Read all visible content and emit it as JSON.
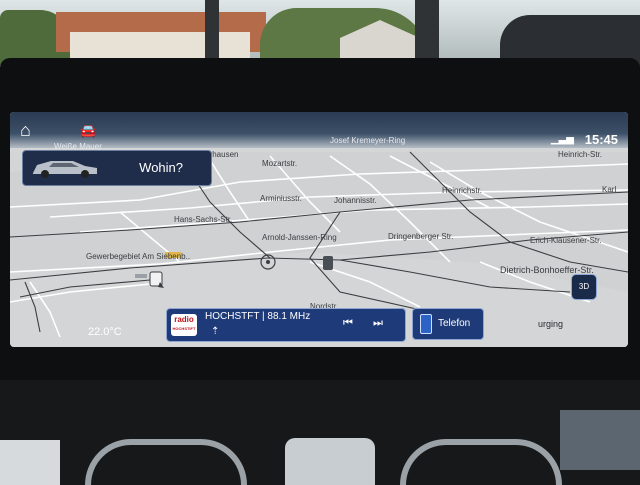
{
  "topbar": {
    "home_icon": "home-icon",
    "car_icon": "car-icon",
    "signal_icon": "signal-icon",
    "time": "15:45"
  },
  "destination_button": {
    "label": "Wohin?"
  },
  "map": {
    "street_labels": {
      "weisse_mauer": "Weiße Mauer",
      "jose_kremeyer": "Josef Kremeyer-Ring",
      "heinrich_str_top": "Heinrich-Str.",
      "thausen": "thausen",
      "mozartstr": "Mozartstr.",
      "heinrichstr": "Heinrichstr.",
      "karl": "Karl",
      "arminiusstr": "Arminiusstr.",
      "johannisstr": "Johannisstr.",
      "hans_sachs": "Hans-Sachs-Str.",
      "arnold_janssen": "Arnold-Janssen-Ring",
      "dringenberger": "Dringenberger Str.",
      "erich_klausener": "Erich-Klausener-Str.",
      "gewerbegebiet": "Gewerbegebiet Am Siebenb..",
      "dietrich": "Dietrich-Bonhoeffer-Str.",
      "nordstr": "Nordstr."
    }
  },
  "bottombar": {
    "temperature": "22.0°C",
    "radio": {
      "logo_text": "radio",
      "logo_subtext": "HOCHSTIFT",
      "station": "HOCHSTFT | 88.1 MHz",
      "prev_icon": "skip-previous-icon",
      "next_icon": "skip-next-icon"
    },
    "phone": {
      "label": "Telefon"
    },
    "climate_label": "urging",
    "view_button": "3D"
  }
}
